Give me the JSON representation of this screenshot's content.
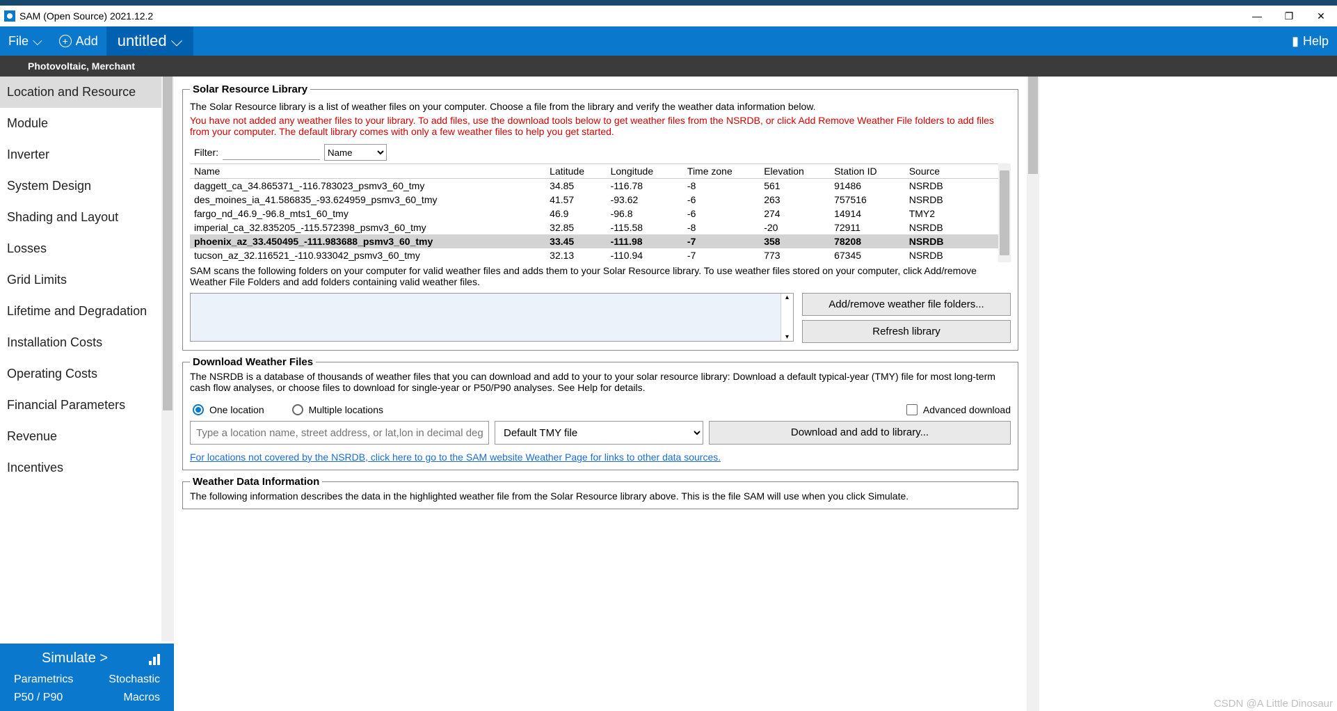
{
  "window": {
    "title": "SAM (Open Source) 2021.12.2"
  },
  "menubar": {
    "file_label": "File",
    "add_label": "Add",
    "tab_label": "untitled",
    "help_label": "Help"
  },
  "subheader": {
    "model_label": "Photovoltaic, Merchant"
  },
  "sidebar": {
    "items": [
      {
        "label": "Location and Resource"
      },
      {
        "label": "Module"
      },
      {
        "label": "Inverter"
      },
      {
        "label": "System Design"
      },
      {
        "label": "Shading and Layout"
      },
      {
        "label": "Losses"
      },
      {
        "label": "Grid Limits"
      },
      {
        "label": "Lifetime and Degradation"
      },
      {
        "label": "Installation Costs"
      },
      {
        "label": "Operating Costs"
      },
      {
        "label": "Financial Parameters"
      },
      {
        "label": "Revenue"
      },
      {
        "label": "Incentives"
      }
    ],
    "simulate": {
      "main": "Simulate >",
      "parametrics": "Parametrics",
      "stochastic": "Stochastic",
      "p50p90": "P50 / P90",
      "macros": "Macros"
    }
  },
  "srl": {
    "legend": "Solar Resource Library",
    "descr": "The Solar Resource library is a list of weather files on your computer. Choose a file from the library and verify the weather data information below.",
    "warn": "You have not added any weather files to your library. To add files, use the download tools below to get weather files from the NSRDB, or click Add Remove Weather File folders to add files from your computer. The default library comes with only a few weather files to help you get started.",
    "filter_label": "Filter:",
    "filter_value": "",
    "filter_field": "Name",
    "table": {
      "headers": [
        "Name",
        "Latitude",
        "Longitude",
        "Time zone",
        "Elevation",
        "Station ID",
        "Source"
      ],
      "rows": [
        {
          "name": "daggett_ca_34.865371_-116.783023_psmv3_60_tmy",
          "lat": "34.85",
          "lon": "-116.78",
          "tz": "-8",
          "ele": "561",
          "sid": "91486",
          "src": "NSRDB"
        },
        {
          "name": "des_moines_ia_41.586835_-93.624959_psmv3_60_tmy",
          "lat": "41.57",
          "lon": "-93.62",
          "tz": "-6",
          "ele": "263",
          "sid": "757516",
          "src": "NSRDB"
        },
        {
          "name": "fargo_nd_46.9_-96.8_mts1_60_tmy",
          "lat": "46.9",
          "lon": "-96.8",
          "tz": "-6",
          "ele": "274",
          "sid": "14914",
          "src": "TMY2"
        },
        {
          "name": "imperial_ca_32.835205_-115.572398_psmv3_60_tmy",
          "lat": "32.85",
          "lon": "-115.58",
          "tz": "-8",
          "ele": "-20",
          "sid": "72911",
          "src": "NSRDB"
        },
        {
          "name": "phoenix_az_33.450495_-111.983688_psmv3_60_tmy",
          "lat": "33.45",
          "lon": "-111.98",
          "tz": "-7",
          "ele": "358",
          "sid": "78208",
          "src": "NSRDB"
        },
        {
          "name": "tucson_az_32.116521_-110.933042_psmv3_60_tmy",
          "lat": "32.13",
          "lon": "-110.94",
          "tz": "-7",
          "ele": "773",
          "sid": "67345",
          "src": "NSRDB"
        }
      ],
      "selected_index": 4
    },
    "scan_note": "SAM scans the following folders on your computer for valid weather files and adds them to your Solar Resource library. To use weather files stored on your computer, click Add/remove Weather File Folders and add folders containing valid weather files.",
    "btn_add_folders": "Add/remove weather file folders...",
    "btn_refresh": "Refresh library"
  },
  "dwl": {
    "legend": "Download Weather Files",
    "descr": "The NSRDB is a database of thousands of weather files that you can download and add to your to your solar resource library: Download a default typical-year (TMY) file for most long-term cash flow analyses, or choose files to download for single-year or P50/P90 analyses. See Help for details.",
    "radio_one": "One location",
    "radio_multi": "Multiple locations",
    "chk_adv": "Advanced download",
    "loc_placeholder": "Type a location name, street address, or lat,lon in decimal degr",
    "file_select": "Default TMY file",
    "btn_download": "Download and add to library...",
    "link_text": "For locations not covered by the NSRDB, click here to go to the SAM website Weather Page for links to other data sources."
  },
  "wdi": {
    "legend": "Weather Data Information",
    "descr": "The following information describes the data in the highlighted weather file from the Solar Resource library above. This is the file SAM will use when you click Simulate."
  },
  "watermark": "CSDN @A Little Dinosaur"
}
